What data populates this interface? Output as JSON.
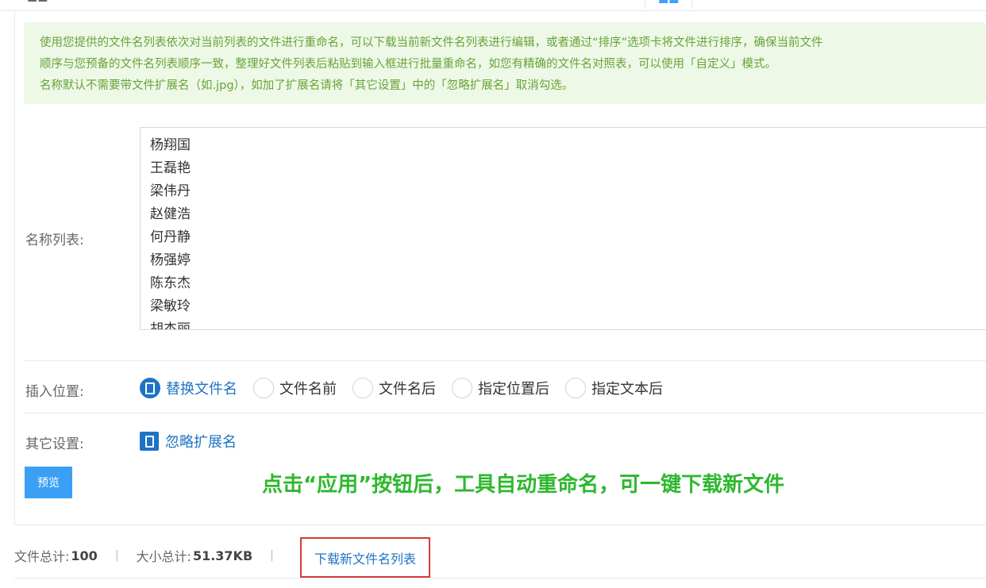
{
  "notice": {
    "line1": "使用您提供的文件名列表依次对当前列表的文件进行重命名，可以下载当前新文件名列表进行编辑，或者通过“排序”选项卡将文件进行排序，确保当前文件",
    "line2": "顺序与您预备的文件名列表顺序一致，整理好文件列表后粘贴到输入框进行批量重命名，如您有精确的文件名对照表，可以使用「自定义」模式。",
    "line3": "名称默认不需要带文件扩展名（如.jpg），如加了扩展名请将「其它设置」中的「忽略扩展名」取消勾选。"
  },
  "name_list": {
    "label": "名称列表:",
    "names": [
      "杨翔国",
      "王磊艳",
      "梁伟丹",
      "赵健浩",
      "何丹静",
      "杨强婷",
      "陈东杰",
      "梁敏玲",
      "胡杰丽"
    ]
  },
  "insert_position": {
    "label": "插入位置:",
    "options": [
      "替换文件名",
      "文件名前",
      "文件名后",
      "指定位置后",
      "指定文本后"
    ],
    "selected": "替换文件名"
  },
  "other_settings": {
    "label": "其它设置:",
    "ignore_ext_label": "忽略扩展名",
    "ignore_ext_checked": true
  },
  "preview_button": "预览",
  "caption": "点击“应用”按钮后，工具自动重命名，可一键下载新文件",
  "stats": {
    "total_files_label": "文件总计:",
    "total_files": "100",
    "total_size_label": "大小总计:",
    "total_size": "51.37KB",
    "separator": "|",
    "download_link": "下载新文件名列表"
  }
}
